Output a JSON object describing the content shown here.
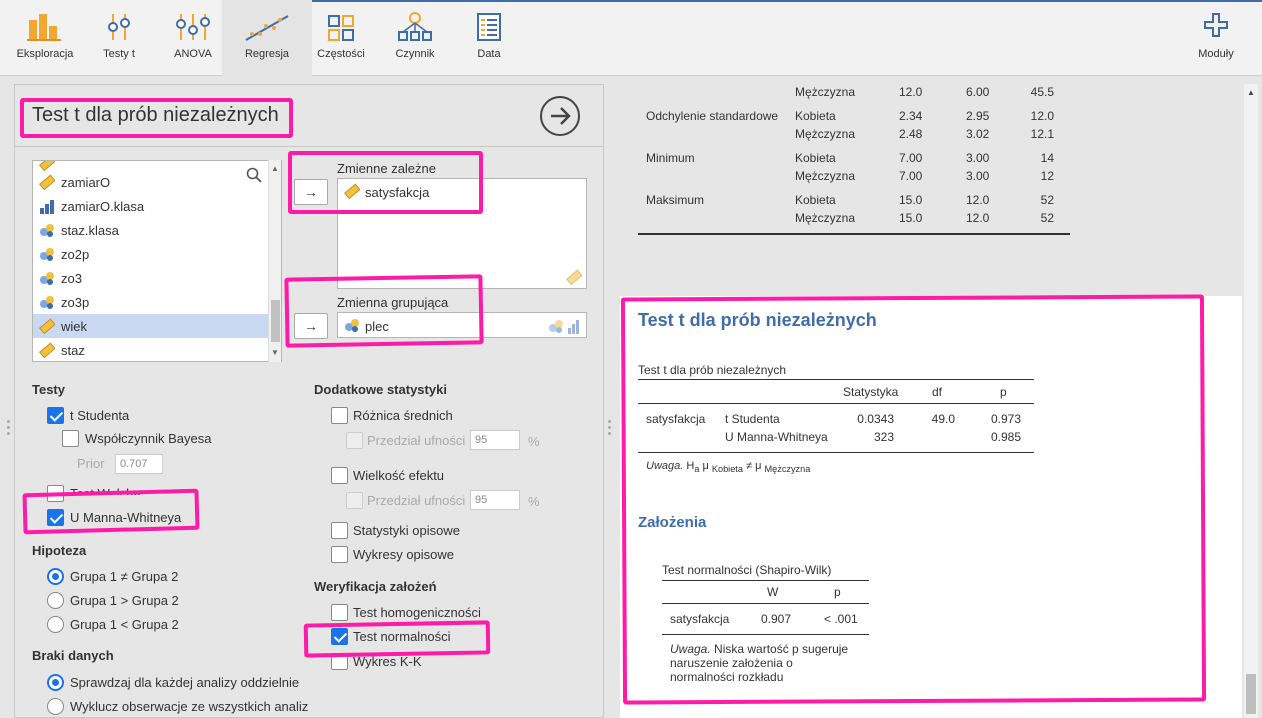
{
  "toolbar": {
    "items": [
      {
        "label": "Eksploracja",
        "icon": "bar-chart-icon"
      },
      {
        "label": "Testy t",
        "icon": "t-test-icon"
      },
      {
        "label": "ANOVA",
        "icon": "anova-icon"
      },
      {
        "label": "Regresja",
        "icon": "regression-icon"
      },
      {
        "label": "Częstości",
        "icon": "frequencies-icon"
      },
      {
        "label": "Czynnik",
        "icon": "factor-icon"
      },
      {
        "label": "Data",
        "icon": "data-icon"
      }
    ],
    "modules_label": "Moduły"
  },
  "analysis": {
    "title": "Test t dla prób niezależnych",
    "variables": [
      {
        "name": "zamiarO",
        "type": "continuous"
      },
      {
        "name": "zamiarO.klasa",
        "type": "ordinal"
      },
      {
        "name": "staz.klasa",
        "type": "nominal"
      },
      {
        "name": "zo2p",
        "type": "nominal"
      },
      {
        "name": "zo3",
        "type": "nominal"
      },
      {
        "name": "zo3p",
        "type": "nominal"
      },
      {
        "name": "wiek",
        "type": "continuous",
        "selected": true
      },
      {
        "name": "staz",
        "type": "continuous"
      }
    ],
    "dependent": {
      "label": "Zmienne zależne",
      "values": [
        "satysfakcja"
      ]
    },
    "grouping": {
      "label": "Zmienna grupująca",
      "value": "plec"
    },
    "tests": {
      "heading": "Testy",
      "student": "t Studenta",
      "bayes": "Współczynnik Bayesa",
      "prior_label": "Prior",
      "prior_value": "0.707",
      "welch": "Test Welcha",
      "mann": "U Manna-Whitneya"
    },
    "hypothesis": {
      "heading": "Hipoteza",
      "options": [
        "Grupa 1 ≠ Grupa 2",
        "Grupa 1 > Grupa 2",
        "Grupa 1 < Grupa 2"
      ]
    },
    "missing": {
      "heading": "Braki danych",
      "options": [
        "Sprawdzaj dla każdej analizy oddzielnie",
        "Wyklucz obserwacje ze wszystkich analiz"
      ]
    },
    "extra": {
      "heading": "Dodatkowe statystyki",
      "mean_diff": "Różnica średnich",
      "ci_label": "Przedział ufności",
      "ci_value": "95",
      "percent": "%",
      "effect": "Wielkość efektu",
      "ci2_label": "Przedział ufności",
      "ci2_value": "95",
      "percent2": "%",
      "descriptives": "Statystyki opisowe",
      "plots": "Wykresy opisowe"
    },
    "assumptions": {
      "heading": "Weryfikacja założeń",
      "homog": "Test homogeniczności",
      "normal": "Test normalności",
      "qq": "Wykres K-K"
    }
  },
  "results": {
    "desc_rows": [
      {
        "stat": "",
        "group": "Mężczyzna",
        "v1": "12.0",
        "v2": "6.00",
        "v3": "45.5"
      },
      {
        "stat": "Odchylenie standardowe",
        "group": "Kobieta",
        "v1": "2.34",
        "v2": "2.95",
        "v3": "12.0"
      },
      {
        "stat": "",
        "group": "Mężczyzna",
        "v1": "2.48",
        "v2": "3.02",
        "v3": "12.1"
      },
      {
        "stat": "Minimum",
        "group": "Kobieta",
        "v1": "7.00",
        "v2": "3.00",
        "v3": "14"
      },
      {
        "stat": "",
        "group": "Mężczyzna",
        "v1": "7.00",
        "v2": "3.00",
        "v3": "12"
      },
      {
        "stat": "Maksimum",
        "group": "Kobieta",
        "v1": "15.0",
        "v2": "12.0",
        "v3": "52"
      },
      {
        "stat": "",
        "group": "Mężczyzna",
        "v1": "15.0",
        "v2": "12.0",
        "v3": "52"
      }
    ],
    "heading": "Test t dla prób niezależnych",
    "table_title": "Test t dla prób niezależnych",
    "cols": {
      "stat": "Statystyka",
      "df": "df",
      "p": "p"
    },
    "rows": [
      {
        "var": "satysfakcja",
        "test": "t Studenta",
        "stat": "0.0343",
        "df": "49.0",
        "p": "0.973"
      },
      {
        "var": "",
        "test": "U Manna-Whitneya",
        "stat": "323",
        "df": "",
        "p": "0.985"
      }
    ],
    "note_prefix": "Uwaga.",
    "note_h": "H",
    "note_a": "a",
    "note_mu": "μ",
    "note_k": "Kobieta",
    "note_neq": "≠",
    "note_mu2": "μ",
    "note_m": "Mężczyzna",
    "assump_heading": "Założenia",
    "normal_title": "Test normalności (Shapiro-Wilk)",
    "normal_cols": {
      "w": "W",
      "p": "p"
    },
    "normal_row": {
      "var": "satysfakcja",
      "w": "0.907",
      "p": "< .001"
    },
    "normal_note_prefix": "Uwaga.",
    "normal_note_l1": "Niska wartość p sugeruje",
    "normal_note_l2": "naruszenie założenia o",
    "normal_note_l3": "normalności rozkładu"
  }
}
